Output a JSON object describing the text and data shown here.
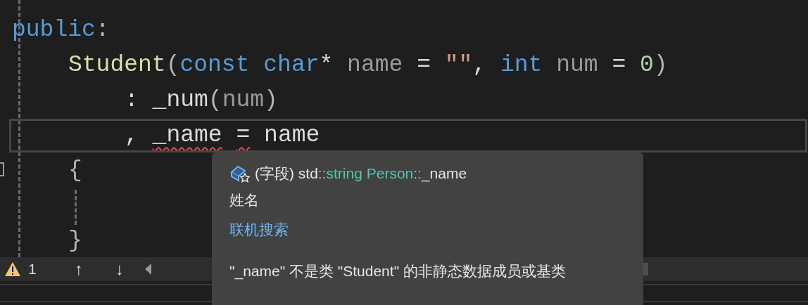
{
  "code_lines": [
    {
      "kind": "line",
      "current": false,
      "tokens": [
        {
          "text": "public",
          "kind": "keyword",
          "error": false
        },
        {
          "text": ":",
          "kind": "punct",
          "error": false
        }
      ],
      "children": [
        {
          "kind": "line",
          "current": false,
          "tokens": [
            {
              "text": "Student",
              "kind": "function",
              "error": false
            },
            {
              "text": "(",
              "kind": "punct",
              "error": false
            },
            {
              "text": "const",
              "kind": "keyword",
              "error": false
            },
            {
              "text": " char",
              "kind": "keyword",
              "error": false
            },
            {
              "text": "* ",
              "kind": "plain",
              "error": false
            },
            {
              "text": "name",
              "kind": "param",
              "error": false
            },
            {
              "text": " = ",
              "kind": "plain",
              "error": false
            },
            {
              "text": "\"\"",
              "kind": "string",
              "error": false
            },
            {
              "text": ", ",
              "kind": "plain",
              "error": false
            },
            {
              "text": "int",
              "kind": "keyword",
              "error": false
            },
            {
              "text": " num",
              "kind": "param",
              "error": false
            },
            {
              "text": " = ",
              "kind": "plain",
              "error": false
            },
            {
              "text": "0",
              "kind": "number",
              "error": false
            },
            {
              "text": ")",
              "kind": "punct",
              "error": false
            }
          ],
          "children": [
            {
              "kind": "line",
              "current": false,
              "tokens": [
                {
                  "text": ": _num",
                  "kind": "plain",
                  "error": false
                },
                {
                  "text": "(",
                  "kind": "punct",
                  "error": false
                },
                {
                  "text": "num",
                  "kind": "param",
                  "error": false
                },
                {
                  "text": ")",
                  "kind": "punct",
                  "error": false
                }
              ]
            },
            {
              "kind": "line",
              "current": true,
              "tokens": [
                {
                  "text": ", ",
                  "kind": "plain",
                  "error": false
                },
                {
                  "text": "_name",
                  "kind": "plain",
                  "error": true
                },
                {
                  "text": " =",
                  "kind": "plain",
                  "error": true
                },
                {
                  "text": " name",
                  "kind": "plain",
                  "error": false
                }
              ]
            }
          ]
        },
        {
          "kind": "block_start",
          "current": false,
          "tokens": [
            {
              "text": "{",
              "kind": "punct",
              "error": false
            }
          ]
        },
        {
          "kind": "line",
          "current": false,
          "tokens": [
            {
              "text": "}",
              "kind": "punct",
              "error": false
            }
          ]
        }
      ]
    }
  ],
  "status_bar": {
    "warning_count": "1",
    "up": "↑",
    "down": "↓"
  },
  "tooltip": {
    "signature": [
      {
        "text": "(字段) std",
        "kind": "plain"
      },
      {
        "text": "::",
        "kind": "punct"
      },
      {
        "text": "string",
        "kind": "type"
      },
      {
        "text": " Person",
        "kind": "type"
      },
      {
        "text": "::",
        "kind": "punct"
      },
      {
        "text": "_name",
        "kind": "plain"
      }
    ],
    "description": "姓名",
    "link": "联机搜索",
    "error_message": "\"_name\" 不是类 \"Student\" 的非静态数据成员或基类"
  }
}
